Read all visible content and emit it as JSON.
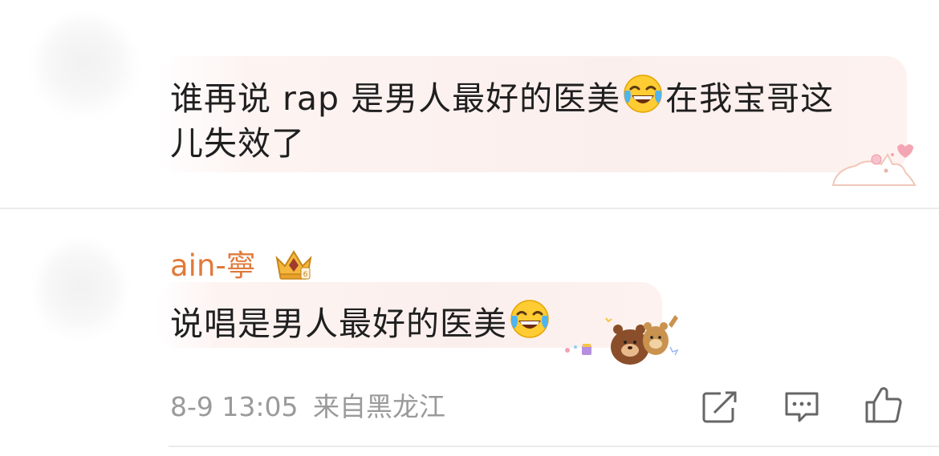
{
  "comment1": {
    "line1": "谁再说 rap 是男人最好的医美",
    "line1_after": "在我宝哥这",
    "line2": "儿失效了"
  },
  "reply": {
    "username": "ain-寧",
    "text": "说唱是男人最好的医美",
    "date": "8-9 13:05",
    "location": "来自黑龙江"
  },
  "icons": {
    "laugh": "face-with-tears-of-joy-icon",
    "badge": "crown-badge-icon",
    "share": "share-icon",
    "comment": "comment-icon",
    "like": "like-icon"
  },
  "colors": {
    "username": "#e07a3a",
    "bubble": "#fbefed",
    "meta": "#9a9a9a"
  }
}
